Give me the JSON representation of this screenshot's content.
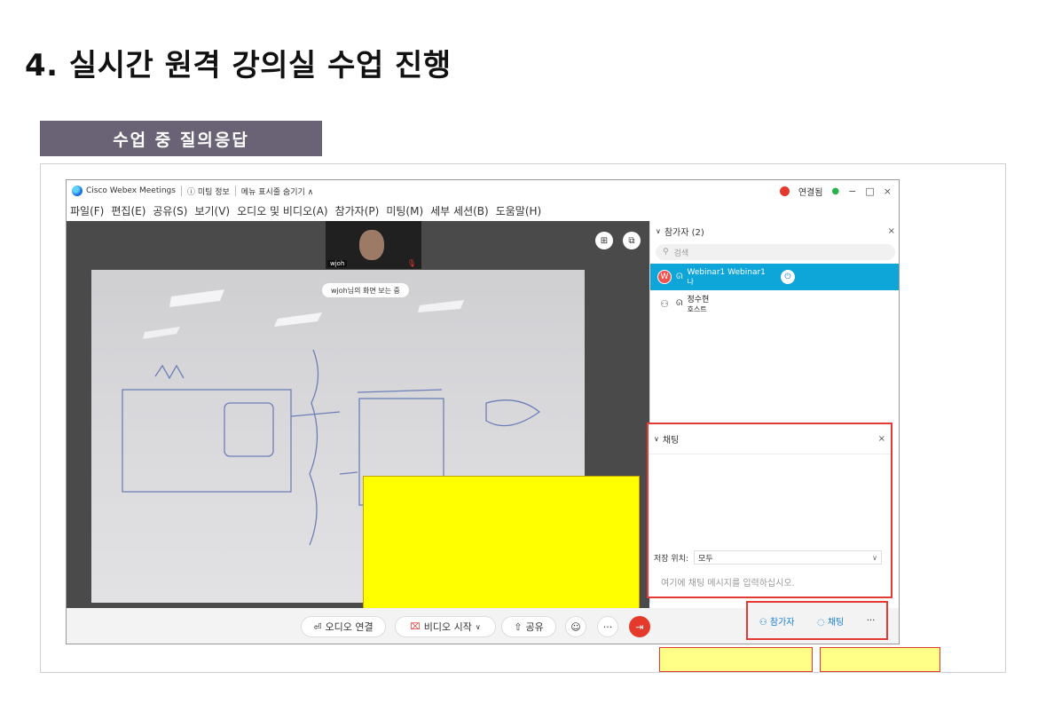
{
  "page": {
    "title": "4. 실시간 원격 강의실 수업 진행",
    "section_banner": "수업 중 질의응답"
  },
  "app": {
    "titlebar": {
      "app_name": "Cisco Webex Meetings",
      "meeting_info": "ⓘ 미팅 정보",
      "hide_menu": "메뉴 표시줄 숨기기 ∧",
      "connected": "연결됨",
      "minimize": "−",
      "maximize": "□",
      "close": "×"
    },
    "menu": [
      "파일(F)",
      "편집(E)",
      "공유(S)",
      "보기(V)",
      "오디오 및 비디오(A)",
      "참가자(P)",
      "미팅(M)",
      "세부 세션(B)",
      "도움말(H)"
    ],
    "video": {
      "thumb_name": "wjoh",
      "viewing_label": "wjoh님의 화면 보는 중",
      "grid_icon": "⊞",
      "popout_icon": "⧉"
    },
    "participants": {
      "header": "참가자 (2)",
      "search_placeholder": "검색",
      "list": [
        {
          "initial": "W",
          "name": "Webinar1 Webinar1",
          "sub": "나"
        },
        {
          "name": "정수현",
          "sub": "호스트"
        }
      ]
    },
    "chat": {
      "header": "채팅",
      "recipient_label": "저장 위치:",
      "recipient_value": "모두",
      "placeholder": "여기에 채팅 메시지를 입력하십시오."
    },
    "toolbar": {
      "audio": "오디오 연결",
      "video": "비디오 시작",
      "share": "공유",
      "participants": "참가자",
      "chat": "채팅",
      "more": "···"
    }
  }
}
